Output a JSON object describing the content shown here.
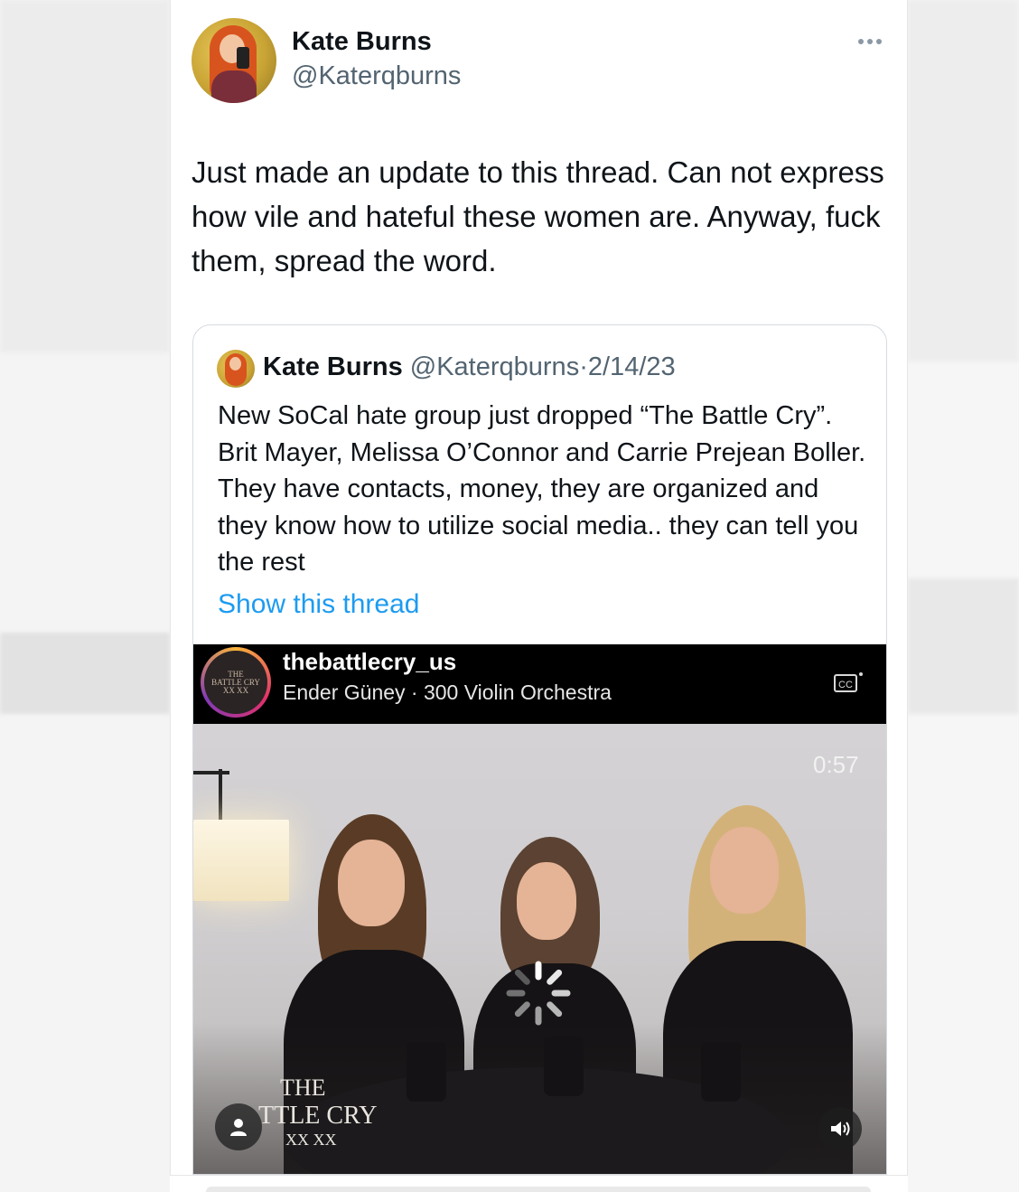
{
  "tweet": {
    "author_name": "Kate Burns",
    "author_handle": "@Katerqburns",
    "more_icon": "more-horizontal-icon",
    "text": "Just made an update to this thread. Can not express how vile and hateful these women are. Anyway, fuck them, spread the word."
  },
  "quote": {
    "author_name": "Kate Burns",
    "author_handle": "@Katerqburns",
    "separator": "·",
    "date": "2/14/23",
    "text": "New SoCal hate group just dropped “The Battle Cry”. Brit Mayer, Melissa O’Connor and Carrie Prejean Boller. They have contacts, money, they are organized and they know how to utilize social media.. they can tell you the rest",
    "show_thread": "Show this thread"
  },
  "video": {
    "account": "thebattlecry_us",
    "audio": "Ender Güney · 300 Violin Orchestra",
    "duration": "0:57",
    "caption_icon": "closed-captions-icon",
    "brand_line1": "THE",
    "brand_line2": "TTLE CRY",
    "brand_line3": "XX XX",
    "avatar_line1": "THE",
    "avatar_line2": "BATTLE CRY",
    "avatar_line3": "XX XX",
    "user_icon": "user-icon",
    "volume_icon": "volume-icon",
    "loading_icon": "loading-spinner-icon"
  },
  "colors": {
    "text_primary": "#0f1419",
    "text_secondary": "#536471",
    "link": "#1d9bf0",
    "border": "#d6dbe0"
  }
}
